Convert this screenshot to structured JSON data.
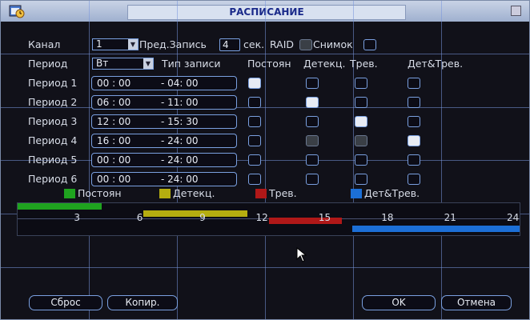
{
  "window": {
    "title": "РАСПИСАНИЕ"
  },
  "form": {
    "channel_label": "Канал",
    "channel_value": "1",
    "prerecord_label": "Пред.Запись",
    "prerecord_value": "4",
    "prerecord_unit": "сек.",
    "raid_label": "RAID",
    "snapshot_label": "Снимок",
    "period_label": "Период",
    "day_value": "Вт",
    "record_type_label": "Тип записи",
    "col_regular": "Постоян",
    "col_motion": "Детекц.",
    "col_alarm": "Трев.",
    "col_motion_alarm": "Дет&Трев."
  },
  "periods": [
    {
      "label": "Период 1",
      "start": "00 : 00",
      "end": "- 04:  00",
      "regular": true,
      "motion": false,
      "alarm": false,
      "motion_alarm": false
    },
    {
      "label": "Период 2",
      "start": "06 : 00",
      "end": "- 11:  00",
      "regular": false,
      "motion": true,
      "alarm": false,
      "motion_alarm": false
    },
    {
      "label": "Период 3",
      "start": "12 : 00",
      "end": "- 15:  30",
      "regular": false,
      "motion": false,
      "alarm": true,
      "motion_alarm": false
    },
    {
      "label": "Период 4",
      "start": "16 : 00",
      "end": "- 24:  00",
      "regular": false,
      "motion": "disabled",
      "alarm": "disabled",
      "motion_alarm": true
    },
    {
      "label": "Период 5",
      "start": "00 : 00",
      "end": "- 24:  00",
      "regular": false,
      "motion": false,
      "alarm": false,
      "motion_alarm": false
    },
    {
      "label": "Период 6",
      "start": "00 : 00",
      "end": "- 24:  00",
      "regular": false,
      "motion": false,
      "alarm": false,
      "motion_alarm": false
    }
  ],
  "legend": [
    {
      "label": "Постоян",
      "color": "#1fa31f"
    },
    {
      "label": "Детекц.",
      "color": "#b5ad10"
    },
    {
      "label": "Трев.",
      "color": "#b01818"
    },
    {
      "label": "Дет&Трев.",
      "color": "#1c6fd6"
    }
  ],
  "timeline": {
    "ticks": [
      "3",
      "6",
      "9",
      "12",
      "15",
      "18",
      "21",
      "24"
    ],
    "segments": [
      {
        "type": "regular",
        "start": 0,
        "end": 4,
        "color": "#1fa31f"
      },
      {
        "type": "motion",
        "start": 6,
        "end": 11,
        "color": "#b5ad10"
      },
      {
        "type": "alarm",
        "start": 12,
        "end": 15.5,
        "color": "#b01818"
      },
      {
        "type": "motion_alarm",
        "start": 16,
        "end": 24,
        "color": "#1c6fd6"
      }
    ]
  },
  "buttons": {
    "reset": "Сброс",
    "copy": "Копир.",
    "ok": "OK",
    "cancel": "Отмена"
  }
}
